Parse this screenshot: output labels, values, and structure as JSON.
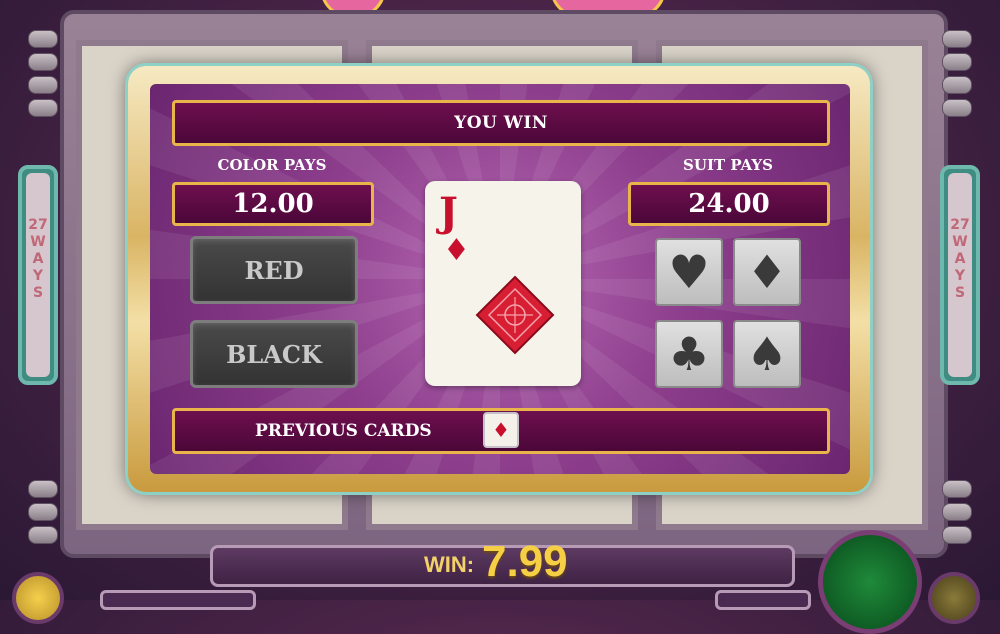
{
  "gamble": {
    "title": "YOU WIN",
    "color_pays_label": "COLOR PAYS",
    "color_pays_value": "12.00",
    "suit_pays_label": "SUIT PAYS",
    "suit_pays_value": "24.00",
    "red_label": "RED",
    "black_label": "BLACK",
    "previous_cards_label": "PREVIOUS CARDS",
    "card": {
      "rank": "J",
      "suit": "diamonds",
      "suit_glyph": "♦"
    },
    "previous_cards": [
      "♦"
    ],
    "suit_buttons": [
      {
        "name": "hearts",
        "glyph": "♥"
      },
      {
        "name": "diamonds",
        "glyph": "♦"
      },
      {
        "name": "clubs",
        "glyph": "♣"
      },
      {
        "name": "spades",
        "glyph": "♠"
      }
    ]
  },
  "ways": {
    "count": "27",
    "letters": [
      "W",
      "A",
      "Y",
      "S"
    ]
  },
  "footer": {
    "win_label": "WIN:",
    "win_value": "7.99"
  },
  "colors": {
    "card_red": "#c8102e",
    "panel_purple": "#8e3f8d",
    "gold_border": "#e9b44a",
    "win_gold": "#f7cf44",
    "spin_green": "#1f8a3a"
  }
}
